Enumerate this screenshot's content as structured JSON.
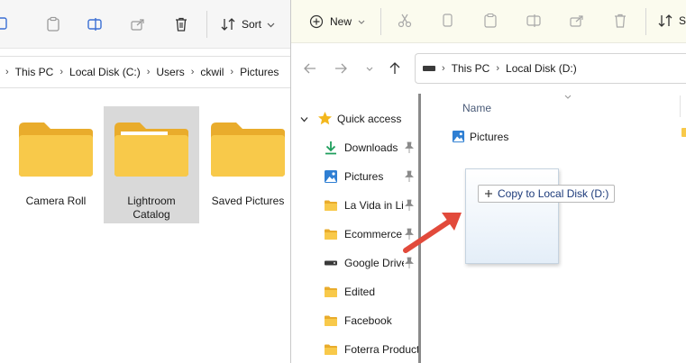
{
  "left_window": {
    "toolbar": {
      "sort_label": "Sort",
      "icons": [
        "copy-icon",
        "paste-icon",
        "rename-icon",
        "share-icon",
        "delete-icon",
        "sort-icon"
      ]
    },
    "breadcrumb": [
      "This PC",
      "Local Disk (C:)",
      "Users",
      "ckwil",
      "Pictures"
    ],
    "folders": [
      {
        "label": "Camera Roll",
        "selected": false
      },
      {
        "label": "Lightroom Catalog",
        "selected": true
      },
      {
        "label": "Saved Pictures",
        "selected": false
      }
    ]
  },
  "right_window": {
    "toolbar": {
      "new_label": "New",
      "sort_label_partial": "S",
      "icons": [
        "cut-icon",
        "copy-icon",
        "paste-icon",
        "rename-icon",
        "share-icon",
        "delete-icon",
        "sort-icon"
      ]
    },
    "navigation": {
      "back_icon": "arrow-left-icon",
      "forward_icon": "arrow-right-icon",
      "recent_icon": "chevron-down-icon",
      "up_icon": "arrow-up-icon"
    },
    "breadcrumb": [
      "This PC",
      "Local Disk (D:)"
    ],
    "nav_pane": {
      "section_label": "Quick access",
      "items": [
        {
          "label": "Downloads",
          "icon": "download-icon",
          "pinned": true
        },
        {
          "label": "Pictures",
          "icon": "pictures-icon",
          "pinned": true
        },
        {
          "label": "La Vida in Li",
          "icon": "folder-icon",
          "pinned": true
        },
        {
          "label": "Ecommerce",
          "icon": "folder-icon",
          "pinned": true
        },
        {
          "label": "Google Drive",
          "icon": "drive-icon",
          "pinned": true
        },
        {
          "label": "Edited",
          "icon": "folder-icon",
          "pinned": false
        },
        {
          "label": "Facebook",
          "icon": "folder-icon",
          "pinned": false
        },
        {
          "label": "Foterra Product",
          "icon": "folder-icon",
          "pinned": false
        }
      ]
    },
    "content": {
      "column_header": "Name",
      "files": [
        {
          "label": "Pictures",
          "icon": "pictures-icon"
        }
      ]
    }
  },
  "drag_overlay": {
    "tooltip_text": "Copy to Local Disk (D:)",
    "tooltip_icon": "plus-icon"
  },
  "colors": {
    "folder_yellow": "#f8c94a",
    "folder_back": "#e9ac2c",
    "star_gold": "#f3b71c",
    "download_green": "#1e9e5c",
    "annotation_red": "#e24a3b",
    "link_blue": "#1c3a7a",
    "selection_gray": "#d9d9d9"
  }
}
